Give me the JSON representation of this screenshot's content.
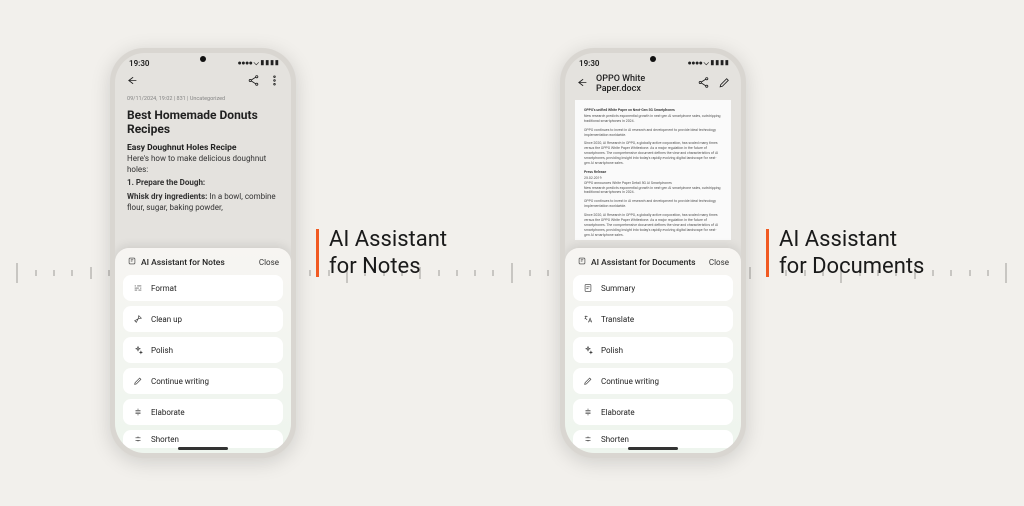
{
  "status": {
    "time": "19:30",
    "indicators": "●●●●  ⌵ ▮▮▮▮"
  },
  "notes": {
    "meta": "09/11/2024, 19:02  |  831  |  Uncategorized",
    "title": "Best Homemade Donuts Recipes",
    "sub": "Easy Doughnut Holes Recipe",
    "line1": "Here's how to make delicious doughnut holes:",
    "step1": "1. Prepare the Dough:",
    "step1b_label": "Whisk dry ingredients:",
    "step1b_rest": " In a bowl, combine flour, sugar, baking powder,"
  },
  "docs": {
    "filename": "OPPO White Paper.docx",
    "p1h": "OPPO's unified White Paper on Next-Gen 5G Smartphones",
    "p1": "New research predicts exponential growth in next-gen AI smartphone sales, outstripping traditional smartphones in 2024.",
    "p2": "OPPO continues to invest in AI research and development to provide ideal technology implementation worldwide.",
    "p3": "Since 2020, AI Research in OPPO, a globally active corporation, has scaled many times versus the OPPO White Paper Whitestone. As a major regulation in the future of smartphones. The comprehensive document defines the view and characteristics of AI smartphones, providing insight into today's rapidly evolving digital landscape for next-gen AI smartphone sales.",
    "p4h": "Press Release",
    "p4d": "25.02.2019",
    "p4t": "OPPO announces White Paper Detail 5G AI Smartphones",
    "p4": "New research predicts exponential growth in next-gen AI smartphone sales, outstripping traditional smartphones in 2024.",
    "p5": "OPPO continues to invest in AI research and development to provide ideal technology implementation worldwide.",
    "p6": "Since 2020, AI Research in OPPO, a globally active corporation, has scaled many times versus the OPPO White Paper Whitestone. As a major regulation in the future of smartphones. The comprehensive document defines the view and characteristics of AI smartphones, providing insight into today's rapidly evolving digital landscape for next-gen AI smartphone sales."
  },
  "sheet_notes": {
    "title": "AI Assistant for Notes",
    "close": "Close",
    "items": [
      {
        "label": "Format"
      },
      {
        "label": "Clean up"
      },
      {
        "label": "Polish"
      },
      {
        "label": "Continue writing"
      },
      {
        "label": "Elaborate"
      },
      {
        "label": "Shorten"
      }
    ]
  },
  "sheet_docs": {
    "title": "AI Assistant for Documents",
    "close": "Close",
    "items": [
      {
        "label": "Summary"
      },
      {
        "label": "Translate"
      },
      {
        "label": "Polish"
      },
      {
        "label": "Continue writing"
      },
      {
        "label": "Elaborate"
      },
      {
        "label": "Shorten"
      }
    ]
  },
  "captions": {
    "left_l1": "AI Assistant",
    "left_l2": "for Notes",
    "right_l1": "AI Assistant",
    "right_l2": "for Documents"
  }
}
